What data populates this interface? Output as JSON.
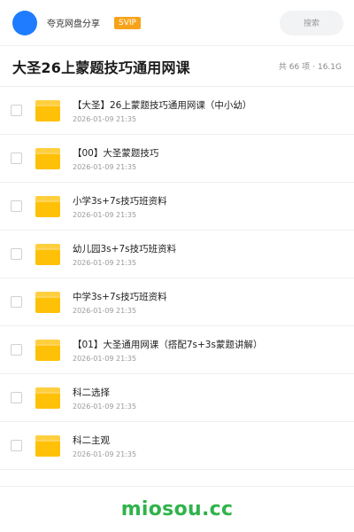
{
  "header": {
    "site_name": "夸克网盘分享",
    "badge": "SVIP",
    "search_label": "搜索"
  },
  "folder": {
    "title": "大圣26上蒙题技巧通用网课",
    "count": "共 66 项",
    "separator": "·",
    "size": "16.1G"
  },
  "items": [
    {
      "name": "【大圣】26上蒙题技巧通用网课（中小幼）",
      "date": "2026-01-09 21:35"
    },
    {
      "name": "【00】大圣蒙题技巧",
      "date": "2026-01-09 21:35"
    },
    {
      "name": "小学3s+7s技巧班资料",
      "date": "2026-01-09 21:35"
    },
    {
      "name": "幼儿园3s+7s技巧班资料",
      "date": "2026-01-09 21:35"
    },
    {
      "name": "中学3s+7s技巧班资料",
      "date": "2026-01-09 21:35"
    },
    {
      "name": "【01】大圣通用网课（搭配7s+3s蒙题讲解）",
      "date": "2026-01-09 21:35"
    },
    {
      "name": "科二选择",
      "date": "2026-01-09 21:35"
    },
    {
      "name": "科二主观",
      "date": "2026-01-09 21:35"
    }
  ],
  "footer": {
    "watermark": "miosou.cc"
  },
  "colors": {
    "avatar": "#1f7cff",
    "badge": "#f7a21b",
    "folder": "#ffc107",
    "watermark": "#2fb34a"
  },
  "icons": {
    "folder": "folder-icon",
    "checkbox": "checkbox-icon"
  }
}
